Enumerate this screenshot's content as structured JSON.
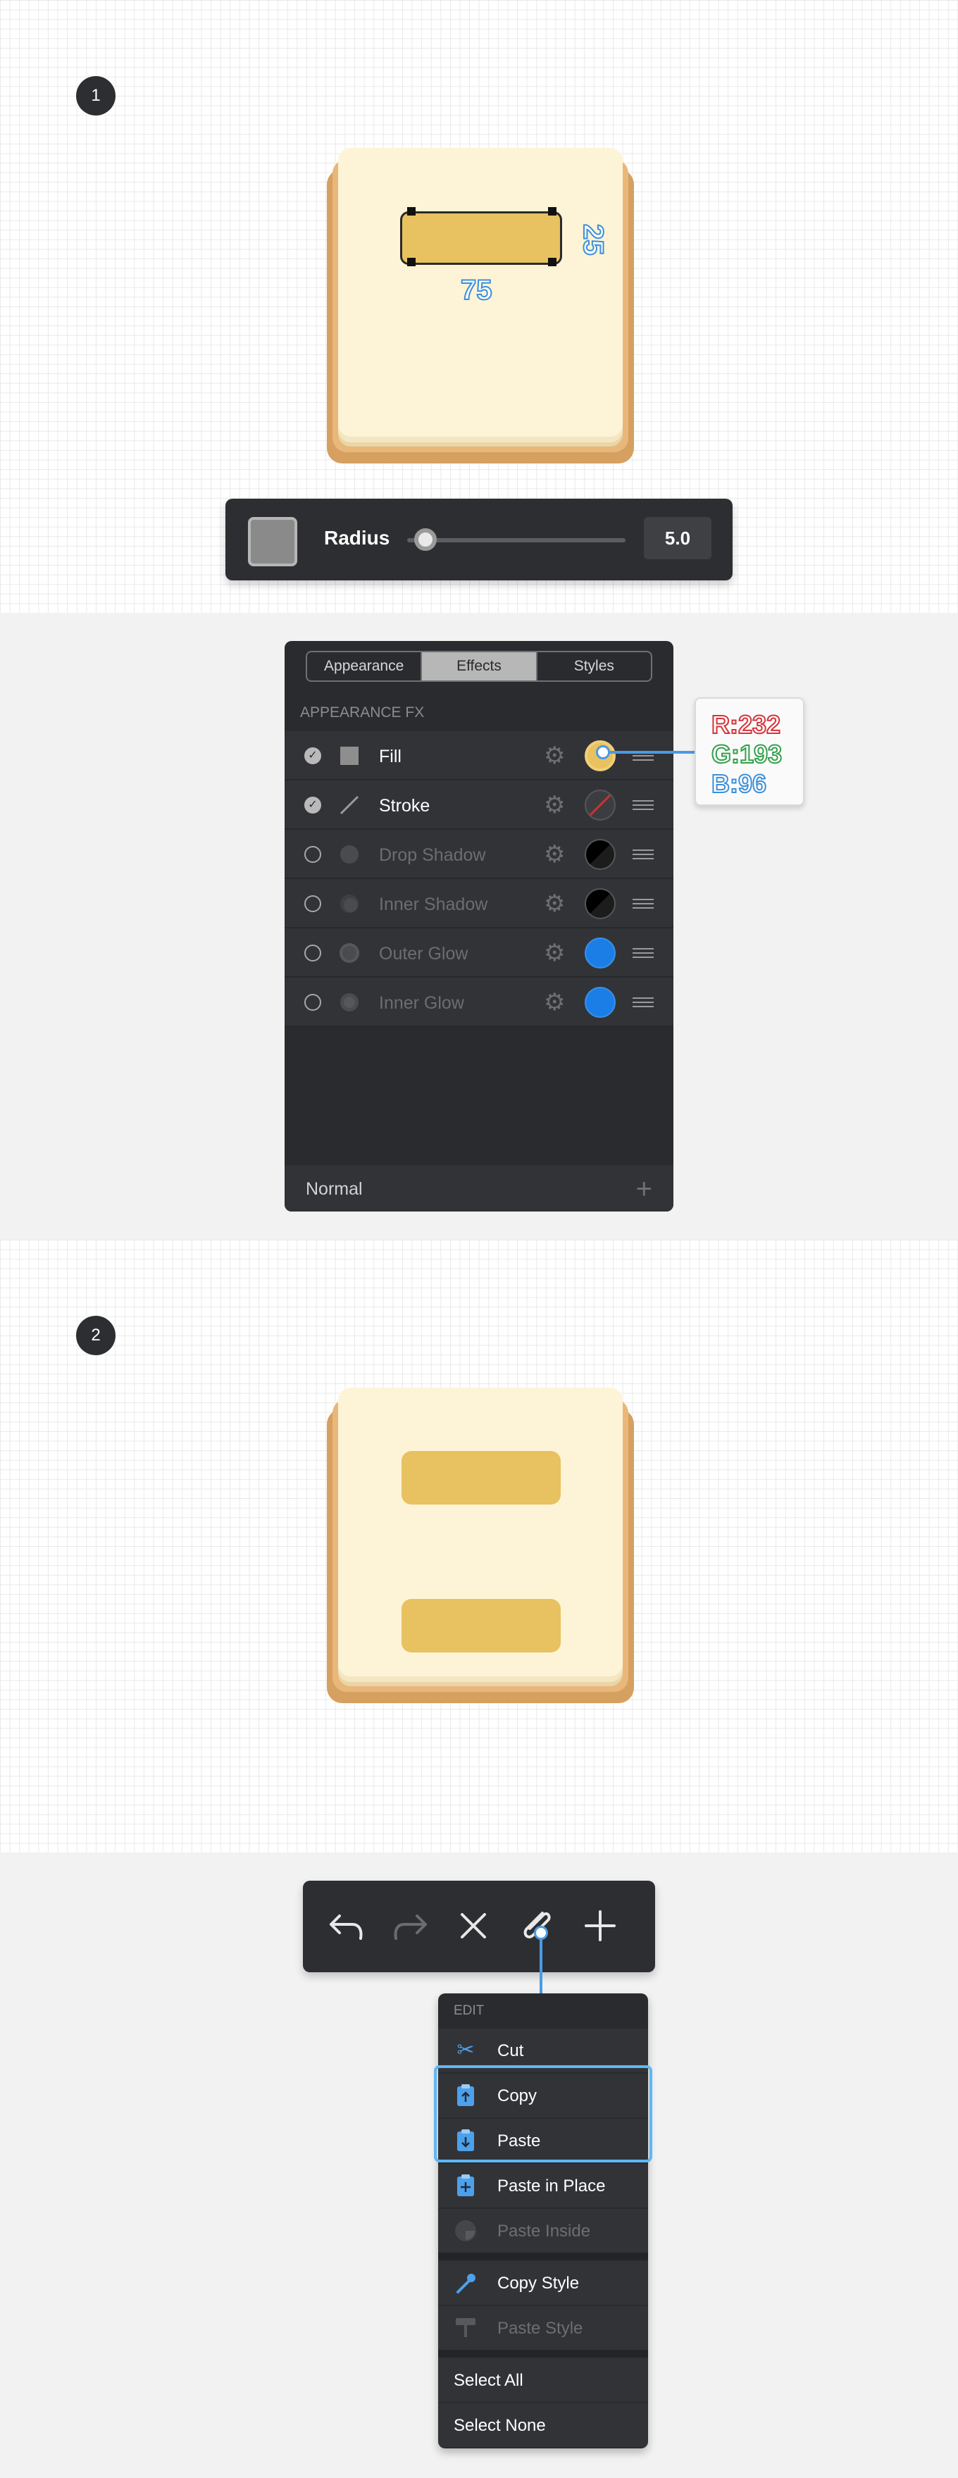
{
  "step_badges": [
    "1",
    "2"
  ],
  "dimensions": {
    "width": "75",
    "height": "25"
  },
  "radius_panel": {
    "label": "Radius",
    "value": "5.0",
    "slider_fraction": 0.1
  },
  "appearance_panel": {
    "tabs": [
      {
        "label": "Appearance",
        "active": false
      },
      {
        "label": "Effects",
        "active": true
      },
      {
        "label": "Styles",
        "active": false
      }
    ],
    "section_header": "APPEARANCE FX",
    "effects": [
      {
        "label": "Fill",
        "enabled": true,
        "icon": "square-icon",
        "color": "#e8c160"
      },
      {
        "label": "Stroke",
        "enabled": true,
        "icon": "line-icon",
        "color": "none-red-slash"
      },
      {
        "label": "Drop Shadow",
        "enabled": false,
        "icon": "circle-icon",
        "color": "#000000"
      },
      {
        "label": "Inner Shadow",
        "enabled": false,
        "icon": "circle-icon",
        "color": "#000000"
      },
      {
        "label": "Outer Glow",
        "enabled": false,
        "icon": "circle-icon",
        "color": "#1a7ee6"
      },
      {
        "label": "Inner Glow",
        "enabled": false,
        "icon": "circle-icon",
        "color": "#1a7ee6"
      }
    ],
    "blend_mode": "Normal"
  },
  "rgb_values": {
    "r": "R:232",
    "g": "G:193",
    "b": "B:96"
  },
  "edit_toolbar": {
    "buttons": [
      "undo-icon",
      "redo-icon",
      "close-icon",
      "paperclip-icon",
      "plus-icon"
    ]
  },
  "edit_menu": {
    "header": "EDIT",
    "items": [
      {
        "label": "Cut",
        "icon": "scissors-icon",
        "enabled": true
      },
      {
        "label": "Copy",
        "icon": "clipboard-up-icon",
        "enabled": true
      },
      {
        "label": "Paste",
        "icon": "clipboard-down-icon",
        "enabled": true
      },
      {
        "label": "Paste in Place",
        "icon": "clipboard-plus-icon",
        "enabled": true
      },
      {
        "label": "Paste Inside",
        "icon": "circle-icon",
        "enabled": false
      },
      {
        "label": "Copy Style",
        "icon": "eyedropper-icon",
        "enabled": true
      },
      {
        "label": "Paste Style",
        "icon": "paint-roller-icon",
        "enabled": false
      },
      {
        "label": "Select All",
        "enabled": true
      },
      {
        "label": "Select None",
        "enabled": true
      }
    ]
  },
  "colors": {
    "fill": "#e8c160",
    "highlight": "#5fb7f5",
    "pad_cream": "#fdf4d7"
  }
}
